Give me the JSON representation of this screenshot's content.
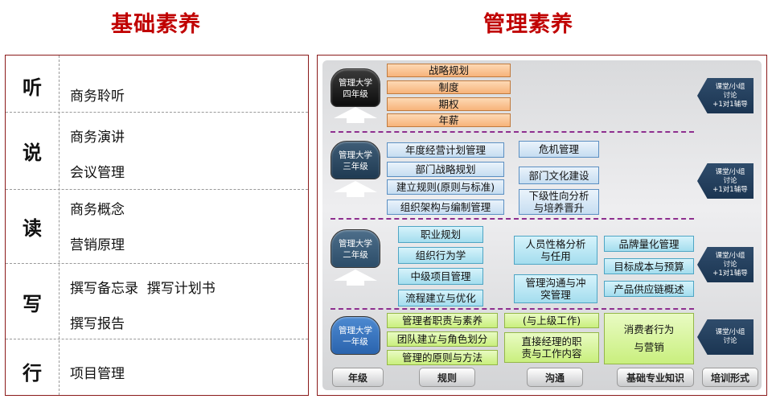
{
  "headings": {
    "left": "基础素养",
    "right": "管理素养"
  },
  "basic": [
    {
      "category": "听",
      "items": [
        "商务聆听"
      ]
    },
    {
      "category": "说",
      "items": [
        "商务演讲",
        "会议管理"
      ]
    },
    {
      "category": "读",
      "items": [
        "商务概念",
        "营销原理"
      ]
    },
    {
      "category": "写",
      "items": [
        "撰写备忘录  撰写计划书",
        "撰写报告"
      ]
    },
    {
      "category": "行",
      "items": [
        "项目管理"
      ]
    }
  ],
  "management": {
    "years": [
      {
        "badge_line1": "管理大学",
        "badge_line2": "四年级",
        "rules": [
          "战略规划",
          "制度",
          "期权",
          "年薪"
        ],
        "format": [
          "课堂/小组",
          "讨论",
          "+1对1辅导"
        ]
      },
      {
        "badge_line1": "管理大学",
        "badge_line2": "三年级",
        "rules": [
          "年度经营计划管理",
          "部门战略规划",
          "建立规则(原则与标准)",
          "组织架构与编制管理"
        ],
        "communication": [
          "危机管理",
          "部门文化建设",
          "下级性向分析\n与培养晋升"
        ],
        "format": [
          "课堂/小组",
          "讨论",
          "+1对1辅导"
        ]
      },
      {
        "badge_line1": "管理大学",
        "badge_line2": "二年级",
        "rules": [
          "职业规划",
          "组织行为学",
          "中级项目管理",
          "流程建立与优化"
        ],
        "communication": [
          "人员性格分析\n与任用",
          "管理沟通与冲\n突管理"
        ],
        "knowledge": [
          "品牌量化管理",
          "目标成本与预算",
          "产品供应链概述"
        ],
        "format": [
          "课堂/小组",
          "讨论",
          "+1对1辅导"
        ]
      },
      {
        "badge_line1": "管理大学",
        "badge_line2": "一年级",
        "rules": [
          "管理者职责与素养",
          "团队建立与角色划分",
          "管理的原则与方法"
        ],
        "communication": [
          "(与上级工作)",
          "直接经理的职\n责与工作内容"
        ],
        "knowledge": [
          "消费者行为\n与营销"
        ],
        "format": [
          "课堂/小组",
          "讨论"
        ]
      }
    ],
    "footer": [
      "年级",
      "规则",
      "沟通",
      "基础专业知识",
      "培训形式"
    ]
  },
  "colors": {
    "heading": "#c00000",
    "border": "#8b1a1a",
    "divider": "#8e2f8f"
  }
}
